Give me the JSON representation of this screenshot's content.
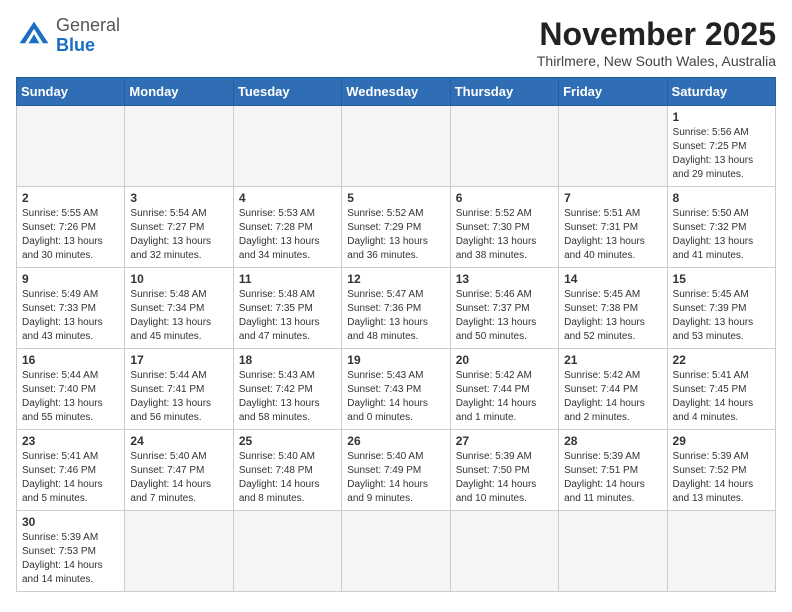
{
  "header": {
    "logo_general": "General",
    "logo_blue": "Blue",
    "month_title": "November 2025",
    "subtitle": "Thirlmere, New South Wales, Australia"
  },
  "days_of_week": [
    "Sunday",
    "Monday",
    "Tuesday",
    "Wednesday",
    "Thursday",
    "Friday",
    "Saturday"
  ],
  "weeks": [
    [
      {
        "day": "",
        "info": ""
      },
      {
        "day": "",
        "info": ""
      },
      {
        "day": "",
        "info": ""
      },
      {
        "day": "",
        "info": ""
      },
      {
        "day": "",
        "info": ""
      },
      {
        "day": "",
        "info": ""
      },
      {
        "day": "1",
        "info": "Sunrise: 5:56 AM\nSunset: 7:25 PM\nDaylight: 13 hours\nand 29 minutes."
      }
    ],
    [
      {
        "day": "2",
        "info": "Sunrise: 5:55 AM\nSunset: 7:26 PM\nDaylight: 13 hours\nand 30 minutes."
      },
      {
        "day": "3",
        "info": "Sunrise: 5:54 AM\nSunset: 7:27 PM\nDaylight: 13 hours\nand 32 minutes."
      },
      {
        "day": "4",
        "info": "Sunrise: 5:53 AM\nSunset: 7:28 PM\nDaylight: 13 hours\nand 34 minutes."
      },
      {
        "day": "5",
        "info": "Sunrise: 5:52 AM\nSunset: 7:29 PM\nDaylight: 13 hours\nand 36 minutes."
      },
      {
        "day": "6",
        "info": "Sunrise: 5:52 AM\nSunset: 7:30 PM\nDaylight: 13 hours\nand 38 minutes."
      },
      {
        "day": "7",
        "info": "Sunrise: 5:51 AM\nSunset: 7:31 PM\nDaylight: 13 hours\nand 40 minutes."
      },
      {
        "day": "8",
        "info": "Sunrise: 5:50 AM\nSunset: 7:32 PM\nDaylight: 13 hours\nand 41 minutes."
      }
    ],
    [
      {
        "day": "9",
        "info": "Sunrise: 5:49 AM\nSunset: 7:33 PM\nDaylight: 13 hours\nand 43 minutes."
      },
      {
        "day": "10",
        "info": "Sunrise: 5:48 AM\nSunset: 7:34 PM\nDaylight: 13 hours\nand 45 minutes."
      },
      {
        "day": "11",
        "info": "Sunrise: 5:48 AM\nSunset: 7:35 PM\nDaylight: 13 hours\nand 47 minutes."
      },
      {
        "day": "12",
        "info": "Sunrise: 5:47 AM\nSunset: 7:36 PM\nDaylight: 13 hours\nand 48 minutes."
      },
      {
        "day": "13",
        "info": "Sunrise: 5:46 AM\nSunset: 7:37 PM\nDaylight: 13 hours\nand 50 minutes."
      },
      {
        "day": "14",
        "info": "Sunrise: 5:45 AM\nSunset: 7:38 PM\nDaylight: 13 hours\nand 52 minutes."
      },
      {
        "day": "15",
        "info": "Sunrise: 5:45 AM\nSunset: 7:39 PM\nDaylight: 13 hours\nand 53 minutes."
      }
    ],
    [
      {
        "day": "16",
        "info": "Sunrise: 5:44 AM\nSunset: 7:40 PM\nDaylight: 13 hours\nand 55 minutes."
      },
      {
        "day": "17",
        "info": "Sunrise: 5:44 AM\nSunset: 7:41 PM\nDaylight: 13 hours\nand 56 minutes."
      },
      {
        "day": "18",
        "info": "Sunrise: 5:43 AM\nSunset: 7:42 PM\nDaylight: 13 hours\nand 58 minutes."
      },
      {
        "day": "19",
        "info": "Sunrise: 5:43 AM\nSunset: 7:43 PM\nDaylight: 14 hours\nand 0 minutes."
      },
      {
        "day": "20",
        "info": "Sunrise: 5:42 AM\nSunset: 7:44 PM\nDaylight: 14 hours\nand 1 minute."
      },
      {
        "day": "21",
        "info": "Sunrise: 5:42 AM\nSunset: 7:44 PM\nDaylight: 14 hours\nand 2 minutes."
      },
      {
        "day": "22",
        "info": "Sunrise: 5:41 AM\nSunset: 7:45 PM\nDaylight: 14 hours\nand 4 minutes."
      }
    ],
    [
      {
        "day": "23",
        "info": "Sunrise: 5:41 AM\nSunset: 7:46 PM\nDaylight: 14 hours\nand 5 minutes."
      },
      {
        "day": "24",
        "info": "Sunrise: 5:40 AM\nSunset: 7:47 PM\nDaylight: 14 hours\nand 7 minutes."
      },
      {
        "day": "25",
        "info": "Sunrise: 5:40 AM\nSunset: 7:48 PM\nDaylight: 14 hours\nand 8 minutes."
      },
      {
        "day": "26",
        "info": "Sunrise: 5:40 AM\nSunset: 7:49 PM\nDaylight: 14 hours\nand 9 minutes."
      },
      {
        "day": "27",
        "info": "Sunrise: 5:39 AM\nSunset: 7:50 PM\nDaylight: 14 hours\nand 10 minutes."
      },
      {
        "day": "28",
        "info": "Sunrise: 5:39 AM\nSunset: 7:51 PM\nDaylight: 14 hours\nand 11 minutes."
      },
      {
        "day": "29",
        "info": "Sunrise: 5:39 AM\nSunset: 7:52 PM\nDaylight: 14 hours\nand 13 minutes."
      }
    ],
    [
      {
        "day": "30",
        "info": "Sunrise: 5:39 AM\nSunset: 7:53 PM\nDaylight: 14 hours\nand 14 minutes."
      },
      {
        "day": "",
        "info": ""
      },
      {
        "day": "",
        "info": ""
      },
      {
        "day": "",
        "info": ""
      },
      {
        "day": "",
        "info": ""
      },
      {
        "day": "",
        "info": ""
      },
      {
        "day": "",
        "info": ""
      }
    ]
  ]
}
